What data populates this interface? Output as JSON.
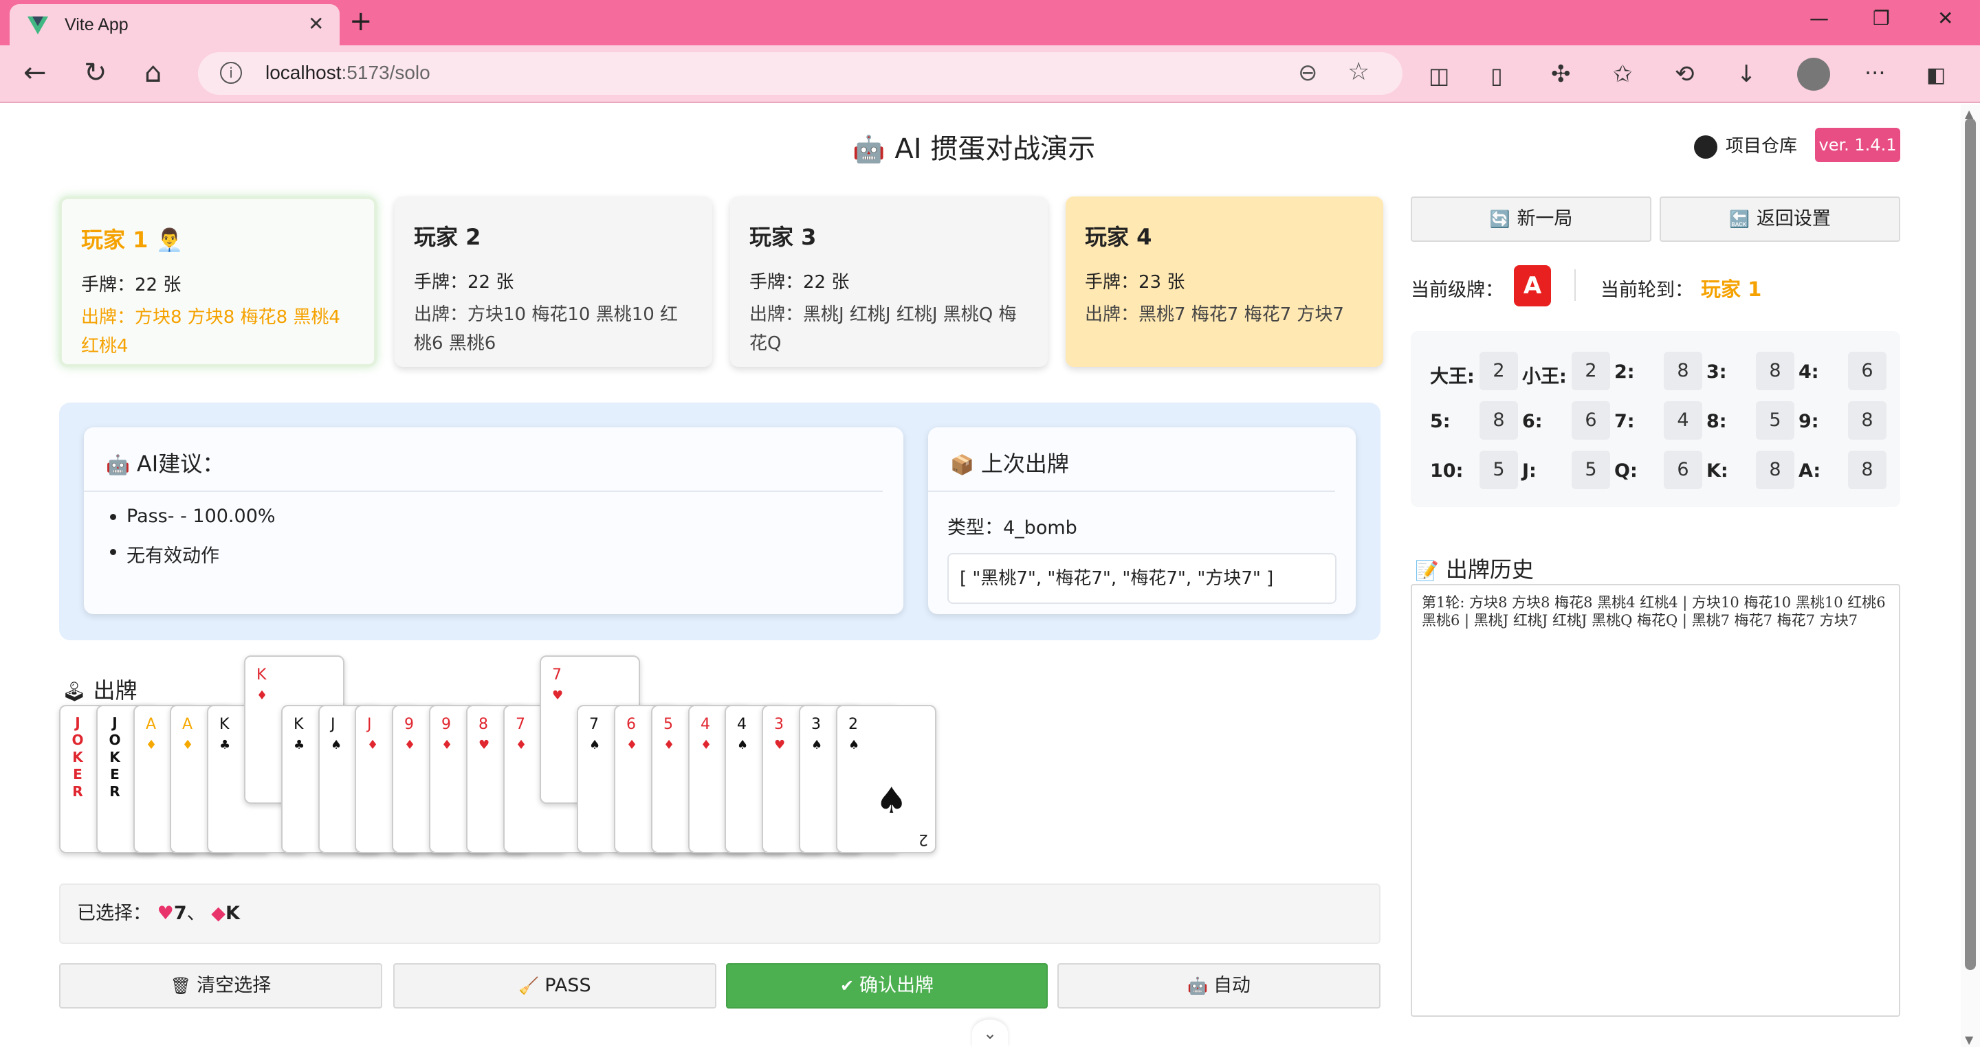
{
  "browser": {
    "tab_title": "Vite App",
    "url_host": "localhost",
    "url_path": ":5173/solo",
    "colors": {
      "chrome": "#f56b9b",
      "toolbar": "#fbd0df"
    }
  },
  "header": {
    "title": "AI 掼蛋对战演示",
    "title_icon": "robot-icon",
    "repo_link": "项目仓库",
    "version": "ver. 1.4.1"
  },
  "players": [
    {
      "name": "玩家 1",
      "hand": "手牌：22 张",
      "played": "出牌：方块8 方块8 梅花8 黑桃4 红桃4"
    },
    {
      "name": "玩家 2",
      "hand": "手牌：22 张",
      "played": "出牌：方块10 梅花10 黑桃10 红桃6 黑桃6"
    },
    {
      "name": "玩家 3",
      "hand": "手牌：22 张",
      "played": "出牌：黑桃J 红桃J 红桃J 黑桃Q 梅花Q"
    },
    {
      "name": "玩家 4",
      "hand": "手牌：23 张",
      "played": "出牌：黑桃7 梅花7 梅花7 方块7"
    }
  ],
  "ai": {
    "title": "AI建议：",
    "suggestions": [
      "Pass- - 100.00%",
      "无有效动作"
    ]
  },
  "last_play": {
    "title": "上次出牌",
    "type": "类型：4_bomb",
    "cards": "[ \"黑桃7\", \"梅花7\", \"梅花7\", \"方块7\" ]"
  },
  "hand": {
    "label": "出牌",
    "cards": [
      {
        "rank": "JOKER",
        "suit": "",
        "color": "red",
        "joker": true
      },
      {
        "rank": "JOKER",
        "suit": "",
        "color": "black",
        "joker": true
      },
      {
        "rank": "A",
        "suit": "♦",
        "color": "gold"
      },
      {
        "rank": "A",
        "suit": "♦",
        "color": "gold"
      },
      {
        "rank": "K",
        "suit": "♣",
        "color": "black"
      },
      {
        "rank": "K",
        "suit": "♦",
        "color": "red",
        "selected": true
      },
      {
        "rank": "K",
        "suit": "♣",
        "color": "black"
      },
      {
        "rank": "J",
        "suit": "♠",
        "color": "black"
      },
      {
        "rank": "J",
        "suit": "♦",
        "color": "red"
      },
      {
        "rank": "9",
        "suit": "♦",
        "color": "red"
      },
      {
        "rank": "9",
        "suit": "♦",
        "color": "red"
      },
      {
        "rank": "8",
        "suit": "♥",
        "color": "red"
      },
      {
        "rank": "7",
        "suit": "♦",
        "color": "red"
      },
      {
        "rank": "7",
        "suit": "♥",
        "color": "red",
        "selected": true
      },
      {
        "rank": "7",
        "suit": "♠",
        "color": "black"
      },
      {
        "rank": "6",
        "suit": "♦",
        "color": "red"
      },
      {
        "rank": "5",
        "suit": "♦",
        "color": "red"
      },
      {
        "rank": "4",
        "suit": "♦",
        "color": "red"
      },
      {
        "rank": "4",
        "suit": "♠",
        "color": "black"
      },
      {
        "rank": "3",
        "suit": "♥",
        "color": "red"
      },
      {
        "rank": "3",
        "suit": "♠",
        "color": "black"
      },
      {
        "rank": "2",
        "suit": "♠",
        "color": "black"
      }
    ]
  },
  "selection": {
    "label": "已选择：",
    "items": [
      "7",
      "K"
    ]
  },
  "actions": {
    "clear": "清空选择",
    "pass": "PASS",
    "confirm": "确认出牌",
    "auto": "自动"
  },
  "side": {
    "new_game": "新一局",
    "back_settings": "返回设置",
    "level_label": "当前级牌：",
    "level_value": "A",
    "turn_label": "当前轮到：",
    "turn_value": "玩家 1",
    "counts": [
      {
        "label": "大王:",
        "value": "2"
      },
      {
        "label": "小王:",
        "value": "2"
      },
      {
        "label": "2:",
        "value": "8"
      },
      {
        "label": "3:",
        "value": "8"
      },
      {
        "label": "4:",
        "value": "6"
      },
      {
        "label": "5:",
        "value": "8"
      },
      {
        "label": "6:",
        "value": "6"
      },
      {
        "label": "7:",
        "value": "4"
      },
      {
        "label": "8:",
        "value": "5"
      },
      {
        "label": "9:",
        "value": "8"
      },
      {
        "label": "10:",
        "value": "5"
      },
      {
        "label": "J:",
        "value": "5"
      },
      {
        "label": "Q:",
        "value": "6"
      },
      {
        "label": "K:",
        "value": "8"
      },
      {
        "label": "A:",
        "value": "8"
      }
    ],
    "history_title": "出牌历史",
    "history_text": "第1轮: 方块8 方块8 梅花8 黑桃4 红桃4 | 方块10 梅花10 黑桃10 红桃6 黑桃6 | 黑桃J 红桃J 红桃J 黑桃Q 梅花Q | 黑桃7 梅花7 梅花7 方块7"
  }
}
